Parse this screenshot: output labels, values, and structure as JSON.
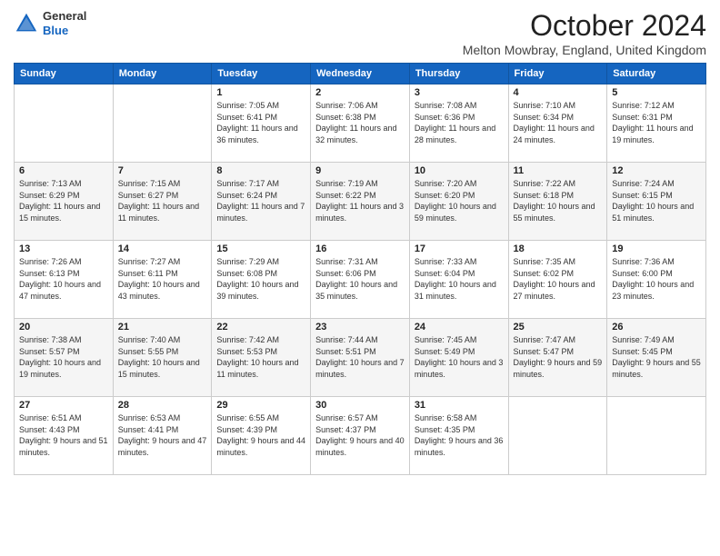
{
  "logo": {
    "general": "General",
    "blue": "Blue"
  },
  "header": {
    "month": "October 2024",
    "subtitle": "Melton Mowbray, England, United Kingdom"
  },
  "days_of_week": [
    "Sunday",
    "Monday",
    "Tuesday",
    "Wednesday",
    "Thursday",
    "Friday",
    "Saturday"
  ],
  "weeks": [
    [
      {
        "day": "",
        "info": ""
      },
      {
        "day": "",
        "info": ""
      },
      {
        "day": "1",
        "info": "Sunrise: 7:05 AM\nSunset: 6:41 PM\nDaylight: 11 hours and 36 minutes."
      },
      {
        "day": "2",
        "info": "Sunrise: 7:06 AM\nSunset: 6:38 PM\nDaylight: 11 hours and 32 minutes."
      },
      {
        "day": "3",
        "info": "Sunrise: 7:08 AM\nSunset: 6:36 PM\nDaylight: 11 hours and 28 minutes."
      },
      {
        "day": "4",
        "info": "Sunrise: 7:10 AM\nSunset: 6:34 PM\nDaylight: 11 hours and 24 minutes."
      },
      {
        "day": "5",
        "info": "Sunrise: 7:12 AM\nSunset: 6:31 PM\nDaylight: 11 hours and 19 minutes."
      }
    ],
    [
      {
        "day": "6",
        "info": "Sunrise: 7:13 AM\nSunset: 6:29 PM\nDaylight: 11 hours and 15 minutes."
      },
      {
        "day": "7",
        "info": "Sunrise: 7:15 AM\nSunset: 6:27 PM\nDaylight: 11 hours and 11 minutes."
      },
      {
        "day": "8",
        "info": "Sunrise: 7:17 AM\nSunset: 6:24 PM\nDaylight: 11 hours and 7 minutes."
      },
      {
        "day": "9",
        "info": "Sunrise: 7:19 AM\nSunset: 6:22 PM\nDaylight: 11 hours and 3 minutes."
      },
      {
        "day": "10",
        "info": "Sunrise: 7:20 AM\nSunset: 6:20 PM\nDaylight: 10 hours and 59 minutes."
      },
      {
        "day": "11",
        "info": "Sunrise: 7:22 AM\nSunset: 6:18 PM\nDaylight: 10 hours and 55 minutes."
      },
      {
        "day": "12",
        "info": "Sunrise: 7:24 AM\nSunset: 6:15 PM\nDaylight: 10 hours and 51 minutes."
      }
    ],
    [
      {
        "day": "13",
        "info": "Sunrise: 7:26 AM\nSunset: 6:13 PM\nDaylight: 10 hours and 47 minutes."
      },
      {
        "day": "14",
        "info": "Sunrise: 7:27 AM\nSunset: 6:11 PM\nDaylight: 10 hours and 43 minutes."
      },
      {
        "day": "15",
        "info": "Sunrise: 7:29 AM\nSunset: 6:08 PM\nDaylight: 10 hours and 39 minutes."
      },
      {
        "day": "16",
        "info": "Sunrise: 7:31 AM\nSunset: 6:06 PM\nDaylight: 10 hours and 35 minutes."
      },
      {
        "day": "17",
        "info": "Sunrise: 7:33 AM\nSunset: 6:04 PM\nDaylight: 10 hours and 31 minutes."
      },
      {
        "day": "18",
        "info": "Sunrise: 7:35 AM\nSunset: 6:02 PM\nDaylight: 10 hours and 27 minutes."
      },
      {
        "day": "19",
        "info": "Sunrise: 7:36 AM\nSunset: 6:00 PM\nDaylight: 10 hours and 23 minutes."
      }
    ],
    [
      {
        "day": "20",
        "info": "Sunrise: 7:38 AM\nSunset: 5:57 PM\nDaylight: 10 hours and 19 minutes."
      },
      {
        "day": "21",
        "info": "Sunrise: 7:40 AM\nSunset: 5:55 PM\nDaylight: 10 hours and 15 minutes."
      },
      {
        "day": "22",
        "info": "Sunrise: 7:42 AM\nSunset: 5:53 PM\nDaylight: 10 hours and 11 minutes."
      },
      {
        "day": "23",
        "info": "Sunrise: 7:44 AM\nSunset: 5:51 PM\nDaylight: 10 hours and 7 minutes."
      },
      {
        "day": "24",
        "info": "Sunrise: 7:45 AM\nSunset: 5:49 PM\nDaylight: 10 hours and 3 minutes."
      },
      {
        "day": "25",
        "info": "Sunrise: 7:47 AM\nSunset: 5:47 PM\nDaylight: 9 hours and 59 minutes."
      },
      {
        "day": "26",
        "info": "Sunrise: 7:49 AM\nSunset: 5:45 PM\nDaylight: 9 hours and 55 minutes."
      }
    ],
    [
      {
        "day": "27",
        "info": "Sunrise: 6:51 AM\nSunset: 4:43 PM\nDaylight: 9 hours and 51 minutes."
      },
      {
        "day": "28",
        "info": "Sunrise: 6:53 AM\nSunset: 4:41 PM\nDaylight: 9 hours and 47 minutes."
      },
      {
        "day": "29",
        "info": "Sunrise: 6:55 AM\nSunset: 4:39 PM\nDaylight: 9 hours and 44 minutes."
      },
      {
        "day": "30",
        "info": "Sunrise: 6:57 AM\nSunset: 4:37 PM\nDaylight: 9 hours and 40 minutes."
      },
      {
        "day": "31",
        "info": "Sunrise: 6:58 AM\nSunset: 4:35 PM\nDaylight: 9 hours and 36 minutes."
      },
      {
        "day": "",
        "info": ""
      },
      {
        "day": "",
        "info": ""
      }
    ]
  ]
}
